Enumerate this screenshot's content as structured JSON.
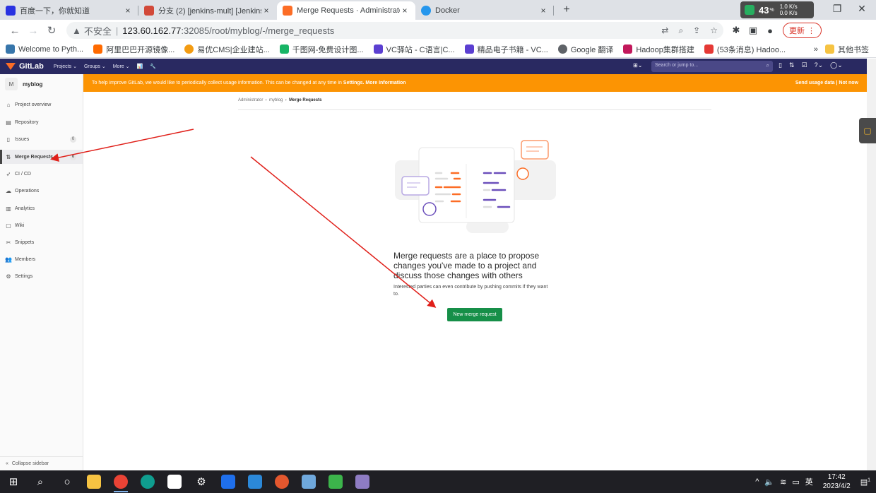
{
  "browser": {
    "tabs": [
      {
        "title": "百度一下，你就知道",
        "color": "#2932e1"
      },
      {
        "title": "分支 (2) [jenkins-mult] [Jenkins",
        "color": "#d24939"
      },
      {
        "title": "Merge Requests · Administrator",
        "color": "#fc6d26",
        "active": true
      },
      {
        "title": "Docker",
        "color": "#2496ed"
      }
    ],
    "tab_close": "×",
    "new_tab": "+",
    "sys_badge": {
      "percent": "43",
      "percent_unit": "%",
      "net_up": "1.0 K/s",
      "net_down": "0.0 K/s"
    },
    "url": {
      "insecure_label": "不安全",
      "host": "123.60.162.77",
      "path": ":32085/root/myblog/-/merge_requests"
    },
    "update_label": "更新",
    "bookmarks": [
      {
        "label": "Welcome to Pyth...",
        "color": "#3776ab"
      },
      {
        "label": "阿里巴巴开源镜像...",
        "color": "#ff6a00"
      },
      {
        "label": "易优CMS|企业建站...",
        "color": "#f39c12"
      },
      {
        "label": "千图网-免费设计图...",
        "color": "#18b566"
      },
      {
        "label": "VC驿站 - C语言|C...",
        "color": "#5b3fd1"
      },
      {
        "label": "精品电子书籍 - VC...",
        "color": "#5b3fd1"
      },
      {
        "label": "Google 翻译",
        "color": "#5f6368"
      },
      {
        "label": "Hadoop集群搭建",
        "color": "#c2185b"
      },
      {
        "label": "(53条消息) Hadoo...",
        "color": "#e53935"
      }
    ],
    "bookmarks_more": "»",
    "other_bookmarks": "其他书签"
  },
  "gitlab": {
    "brand": "GitLab",
    "nav": [
      "Projects ⌄",
      "Groups ⌄",
      "More ⌄"
    ],
    "search_placeholder": "Search or jump to...",
    "project": {
      "avatar_letter": "M",
      "name": "myblog"
    },
    "sidebar": [
      {
        "label": "Project overview",
        "icon": "home-icon"
      },
      {
        "label": "Repository",
        "icon": "doc-icon"
      },
      {
        "label": "Issues",
        "icon": "issues-icon",
        "count": "0"
      },
      {
        "label": "Merge Requests",
        "icon": "merge-icon",
        "count": "0",
        "active": true
      },
      {
        "label": "CI / CD",
        "icon": "rocket-icon"
      },
      {
        "label": "Operations",
        "icon": "cloud-icon"
      },
      {
        "label": "Analytics",
        "icon": "chart-icon"
      },
      {
        "label": "Wiki",
        "icon": "book-icon"
      },
      {
        "label": "Snippets",
        "icon": "scissors-icon"
      },
      {
        "label": "Members",
        "icon": "users-icon"
      },
      {
        "label": "Settings",
        "icon": "gear-icon"
      }
    ],
    "collapse_label": "Collapse sidebar",
    "banner": {
      "text": "To help improve GitLab, we would like to periodically collect usage information. This can be changed at any time in",
      "settings_link": "Settings.",
      "more_link": "More Information",
      "send_usage": "Send usage data",
      "divider": "|",
      "not_now": "Not now"
    },
    "breadcrumb": [
      "Administrator",
      "myblog",
      "Merge Requests"
    ],
    "empty_state": {
      "title": "Merge requests are a place to propose changes you've made to a project and discuss those changes with others",
      "subtitle": "Interested parties can even contribute by pushing commits if they want to.",
      "button": "New merge request"
    }
  },
  "taskbar": {
    "apps": [
      {
        "name": "explorer",
        "color": "#f6c342"
      },
      {
        "name": "chrome",
        "color": "#ea4335",
        "running": true
      },
      {
        "name": "edge",
        "color": "#0f9d8f"
      },
      {
        "name": "typora",
        "color": "#ffffff"
      },
      {
        "name": "settings",
        "color": "#cccccc"
      },
      {
        "name": "feishu",
        "color": "#1f6feb"
      },
      {
        "name": "media",
        "color": "#2b88d8"
      },
      {
        "name": "app-red",
        "color": "#e4572e"
      },
      {
        "name": "app-pen",
        "color": "#6fa8dc"
      },
      {
        "name": "app-green",
        "color": "#3cb44b"
      },
      {
        "name": "app-img",
        "color": "#8e7cc3"
      }
    ],
    "ime": "英",
    "time": "17:42",
    "date": "2023/4/2",
    "notif_count": "1"
  }
}
